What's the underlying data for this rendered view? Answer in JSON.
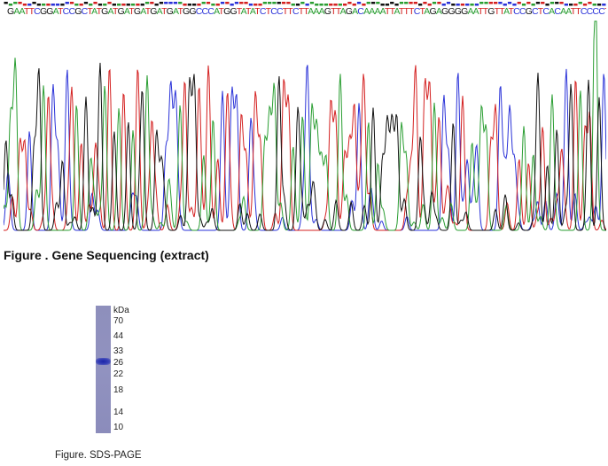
{
  "sequence": {
    "bases": "GAATTCGGATCCGCTATGATGATGATGATGATGGCCCATGGTATATCTCCTTCTTAAAGTTAGACAAAATTATTTCTAGAGGGGAATTGTTATCCGCTCACAATTCCCCTATAGTGAGTCGTATTAGC",
    "colors": {
      "A": "#2a9e32",
      "C": "#2a32d8",
      "G": "#111111",
      "T": "#d42020"
    }
  },
  "figure1": {
    "caption": "Figure . Gene Sequencing (extract)"
  },
  "figure2": {
    "caption": "Figure. SDS-PAGE",
    "unit_label": "kDa",
    "markers": [
      "70",
      "44",
      "33",
      "26",
      "22",
      "18",
      "14",
      "10"
    ],
    "band_kda": "27"
  }
}
